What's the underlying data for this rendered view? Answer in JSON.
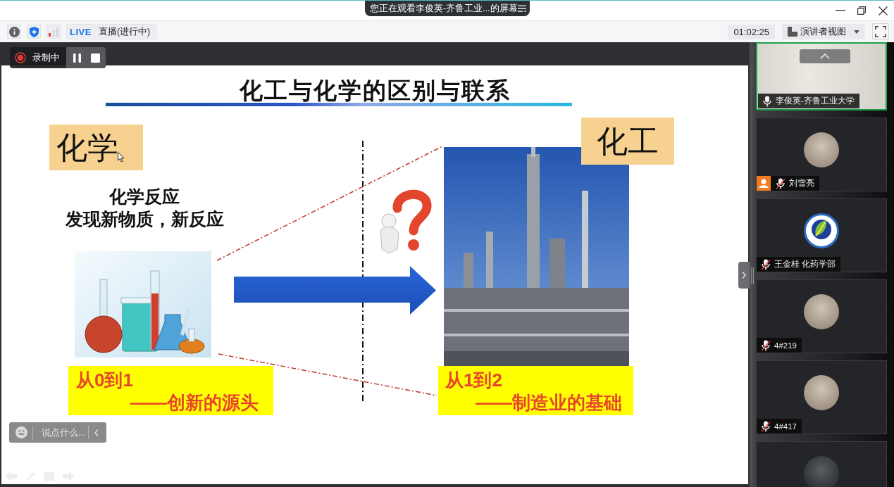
{
  "title_bar": {
    "share_banner": "您正在观看李俊英-齐鲁工业...的屏幕"
  },
  "toolbar": {
    "live_badge": "LIVE",
    "live_status": "直播(进行中)",
    "timer": "01:02:25",
    "view_menu": "演讲者视图"
  },
  "recording": {
    "label": "录制中"
  },
  "slide": {
    "title": "化工与化学的区别与联系",
    "left": {
      "heading": "化学",
      "lines": [
        "化学反应",
        "发现新物质，新反应"
      ],
      "caption": [
        "从0到1",
        "——创新的源头"
      ]
    },
    "right": {
      "heading": "化工",
      "caption": [
        "从1到2",
        "——制造业的基础"
      ]
    }
  },
  "chat": {
    "placeholder": "说点什么..."
  },
  "participants": {
    "more_above": true,
    "more_below": true,
    "tiles": [
      {
        "name": "李俊英-齐鲁工业大学",
        "kind": "video",
        "speaking": true,
        "muted": false,
        "person_badge": false
      },
      {
        "name": "刘雪亮",
        "kind": "photo",
        "speaking": false,
        "muted": true,
        "person_badge": true
      },
      {
        "name": "王金桂 化药学部",
        "kind": "logo",
        "speaking": false,
        "muted": true,
        "person_badge": false
      },
      {
        "name": "4#219",
        "kind": "photo",
        "speaking": false,
        "muted": true,
        "person_badge": false
      },
      {
        "name": "4#417",
        "kind": "photo",
        "speaking": false,
        "muted": true,
        "person_badge": false
      }
    ]
  }
}
